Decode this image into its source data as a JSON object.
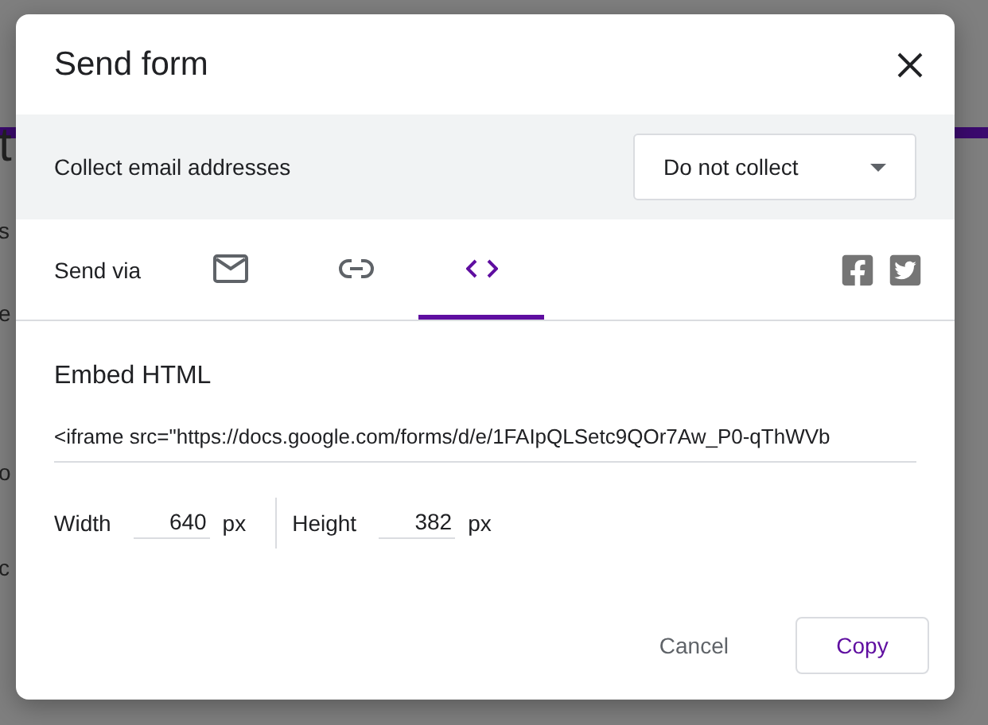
{
  "background": {
    "fragments": [
      "t",
      "s",
      "e",
      "o",
      "c"
    ]
  },
  "dialog": {
    "title": "Send form",
    "collect": {
      "label": "Collect email addresses",
      "value": "Do not collect"
    },
    "send_via": {
      "label": "Send via",
      "tabs": [
        {
          "kind": "email",
          "selected": false
        },
        {
          "kind": "link",
          "selected": false
        },
        {
          "kind": "embed",
          "selected": true
        }
      ],
      "social": [
        {
          "kind": "facebook"
        },
        {
          "kind": "twitter"
        }
      ]
    },
    "embed": {
      "heading": "Embed HTML",
      "code": "<iframe src=\"https://docs.google.com/forms/d/e/1FAIpQLSetc9QOr7Aw_P0-qThWVb",
      "width": {
        "label": "Width",
        "value": "640",
        "unit": "px"
      },
      "height": {
        "label": "Height",
        "value": "382",
        "unit": "px"
      }
    },
    "buttons": [
      {
        "kind": "text",
        "label": "Cancel"
      },
      {
        "kind": "outlined",
        "label": "Copy"
      }
    ]
  }
}
